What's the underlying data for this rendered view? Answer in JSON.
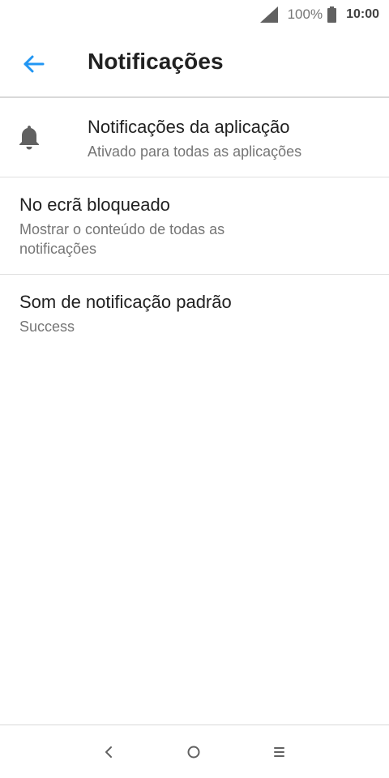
{
  "status_bar": {
    "battery_percent": "100%",
    "time": "10:00",
    "icons": [
      "signal-icon",
      "battery-icon"
    ]
  },
  "header": {
    "title": "Notificações",
    "back_icon": "arrow-left-icon",
    "accent_color": "#2196f3"
  },
  "settings": {
    "items": [
      {
        "title": "Notificações da aplicação",
        "subtitle": "Ativado para todas as aplicações",
        "icon": "bell-icon"
      },
      {
        "title": "No ecrã bloqueado",
        "subtitle": "Mostrar o conteúdo de todas as notificações"
      },
      {
        "title": "Som de notificação padrão",
        "subtitle": "Success"
      }
    ]
  },
  "nav_bar": {
    "icons": [
      "back-icon",
      "home-icon",
      "menu-icon"
    ]
  }
}
